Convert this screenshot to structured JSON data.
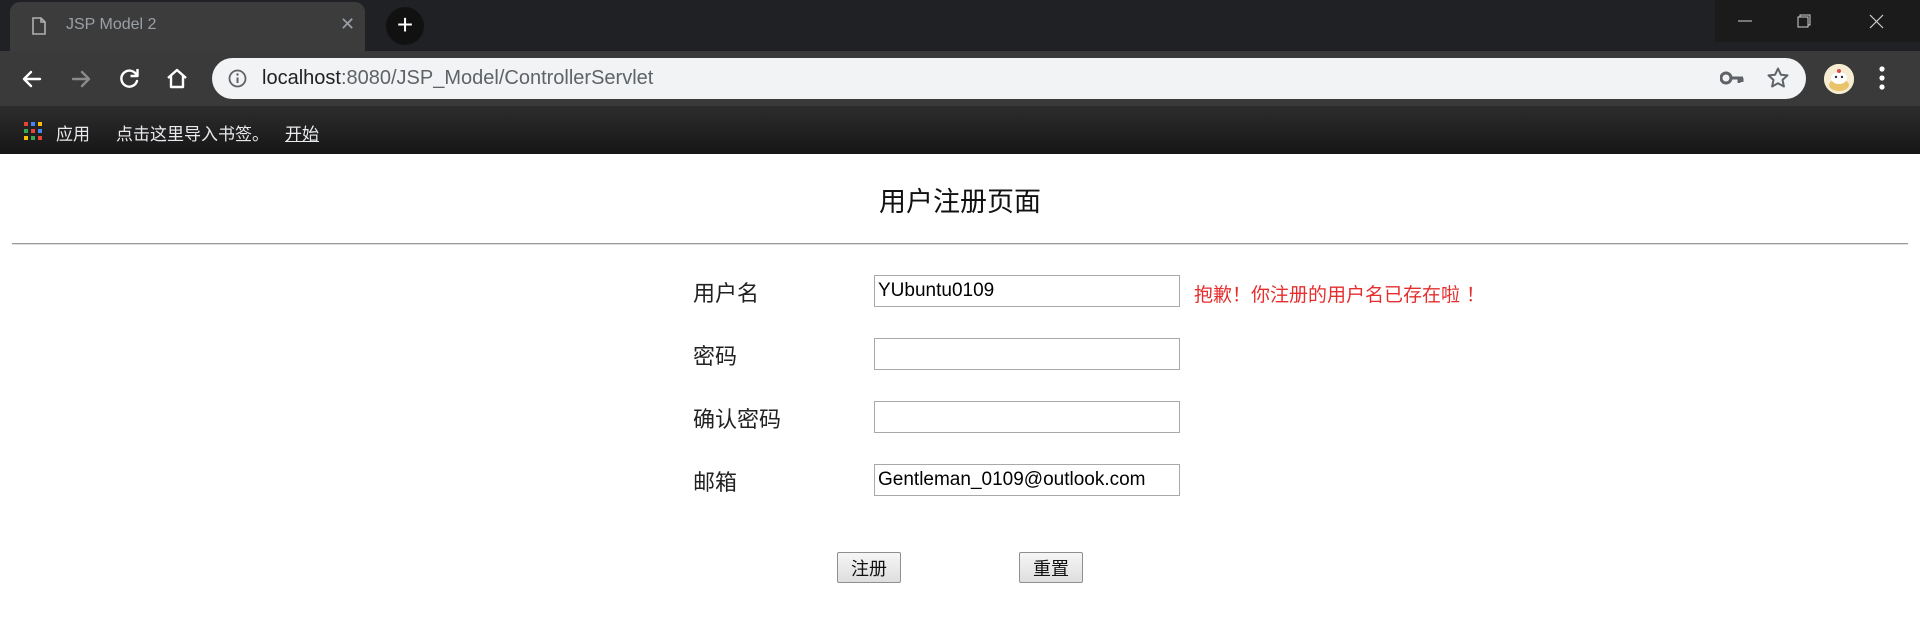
{
  "browser": {
    "tab": {
      "title": "JSP Model 2",
      "close_symbol": "✕"
    },
    "new_tab_symbol": "+",
    "url": {
      "host": "localhost",
      "path": ":8080/JSP_Model/ControllerServlet"
    },
    "bookmarks": {
      "apps_label": "应用",
      "import_prompt": "点击这里导入书签。",
      "start_link": "开始"
    }
  },
  "page": {
    "title": "用户注册页面",
    "fields": {
      "username": {
        "label": "用户名",
        "value": "YUbuntu0109"
      },
      "password": {
        "label": "密码",
        "value": ""
      },
      "confirm_password": {
        "label": "确认密码",
        "value": ""
      },
      "email": {
        "label": "邮箱",
        "value": "Gentleman_0109@outlook.com"
      }
    },
    "error_message": "抱歉！你注册的用户名已存在啦 ！",
    "buttons": {
      "submit": "注册",
      "reset": "重置"
    }
  }
}
